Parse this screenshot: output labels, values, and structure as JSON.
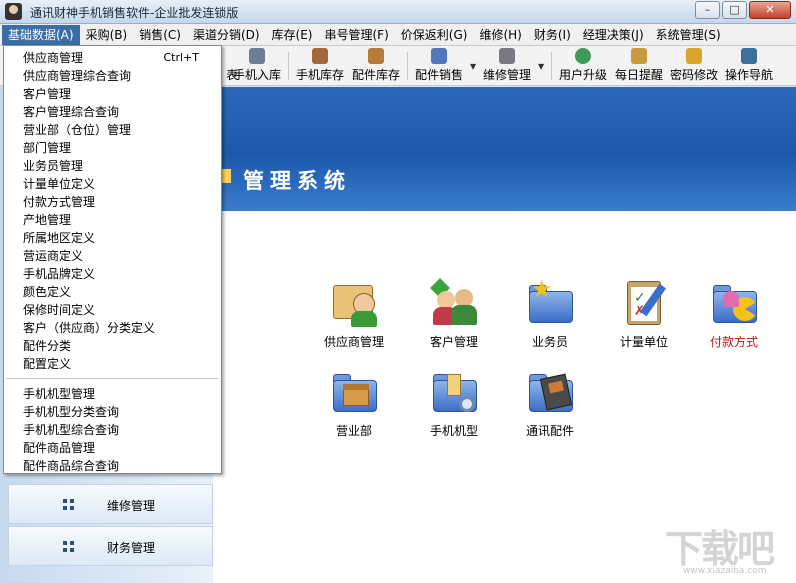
{
  "window": {
    "title": "通讯财神手机销售软件-企业批发连锁版",
    "controls": {
      "minimize": "–",
      "maximize": "□",
      "close": "✕"
    }
  },
  "menubar": [
    "基础数据(A)",
    "采购(B)",
    "销售(C)",
    "渠道分销(D)",
    "库存(E)",
    "串号管理(F)",
    "价保返利(G)",
    "维修(H)",
    "财务(I)",
    "经理决策(J)",
    "系统管理(S)"
  ],
  "toolbar": {
    "partial_label": "表",
    "buttons": [
      "手机入库",
      "手机库存",
      "配件库存",
      "配件销售",
      "维修管理",
      "用户升级",
      "每日提醒",
      "密码修改",
      "操作导航"
    ]
  },
  "dropdown": {
    "group1": [
      "供应商管理",
      "供应商管理综合查询",
      "客户管理",
      "客户管理综合查询",
      "营业部（仓位）管理",
      "部门管理",
      "业务员管理",
      "计量单位定义",
      "付款方式管理",
      "产地管理",
      "所属地区定义",
      "营运商定义",
      "手机品牌定义",
      "颜色定义",
      "保修时间定义",
      "客户（供应商）分类定义",
      "配件分类",
      "配置定义"
    ],
    "shortcut": "Ctrl+T",
    "group2": [
      "手机机型管理",
      "手机机型分类查询",
      "手机机型综合查询",
      "配件商品管理",
      "配件商品综合查询"
    ]
  },
  "banner": {
    "title": "管理系统"
  },
  "modules": {
    "row1": [
      "供应商管理",
      "客户管理",
      "业务员",
      "计量单位",
      "付款方式"
    ],
    "row2": [
      "营业部",
      "手机机型",
      "通讯配件"
    ],
    "highlight_color": "#c81010"
  },
  "sidebar_nav": [
    "维修管理",
    "财务管理"
  ],
  "watermark": {
    "text": "下载吧",
    "url": "www.xiazaiba.com"
  }
}
